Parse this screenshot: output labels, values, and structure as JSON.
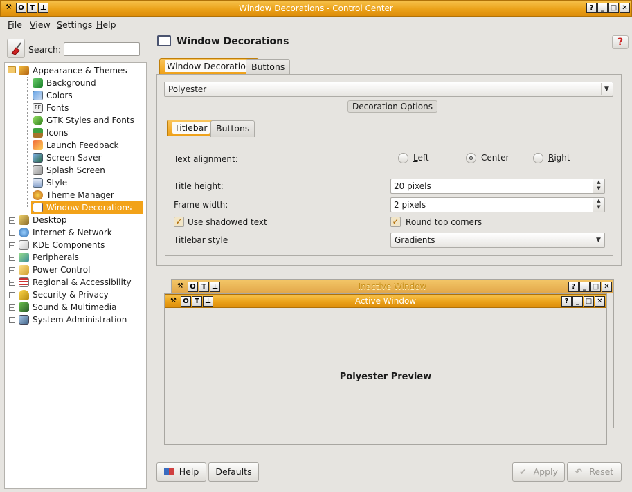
{
  "window": {
    "title": "Window Decorations - Control Center",
    "left_buttons": [
      "X",
      "O",
      "T",
      "⊥"
    ],
    "right_buttons": [
      "?",
      "_",
      "□",
      "✕"
    ]
  },
  "menubar": [
    "File",
    "View",
    "Settings",
    "Help"
  ],
  "search": {
    "label": "Search:",
    "placeholder": ""
  },
  "tree": {
    "appearance": {
      "label": "Appearance & Themes",
      "children": [
        "Background",
        "Colors",
        "Fonts",
        "GTK Styles and Fonts",
        "Icons",
        "Launch Feedback",
        "Screen Saver",
        "Splash Screen",
        "Style",
        "Theme Manager",
        "Window Decorations"
      ]
    },
    "categories": [
      "Desktop",
      "Internet & Network",
      "KDE Components",
      "Peripherals",
      "Power Control",
      "Regional & Accessibility",
      "Security & Privacy",
      "Sound & Multimedia",
      "System Administration"
    ]
  },
  "module": {
    "title": "Window Decorations",
    "tabs": [
      "Window Decoration",
      "Buttons"
    ],
    "decoration_select": "Polyester",
    "options_label": "Decoration Options",
    "subtabs": [
      "Titlebar",
      "Buttons"
    ],
    "text_alignment_label": "Text alignment:",
    "alignment_options": [
      "Left",
      "Center",
      "Right"
    ],
    "alignment_selected": "Center",
    "title_height_label": "Title height:",
    "title_height_value": "20 pixels",
    "frame_width_label": "Frame width:",
    "frame_width_value": "2 pixels",
    "shadowed_text_label": "Use shadowed text",
    "shadowed_text_checked": true,
    "round_corners_label": "Round top corners",
    "round_corners_checked": true,
    "titlebar_style_label": "Titlebar style",
    "titlebar_style_value": "Gradients"
  },
  "preview": {
    "inactive_title": "Inactive Window",
    "active_title": "Active Window",
    "text": "Polyester Preview"
  },
  "footer": {
    "help": "Help",
    "defaults": "Defaults",
    "apply": "Apply",
    "reset": "Reset"
  },
  "colors": {
    "accent": "#eba21a",
    "selected": "#f2a219",
    "bg": "#e6e4e0"
  }
}
